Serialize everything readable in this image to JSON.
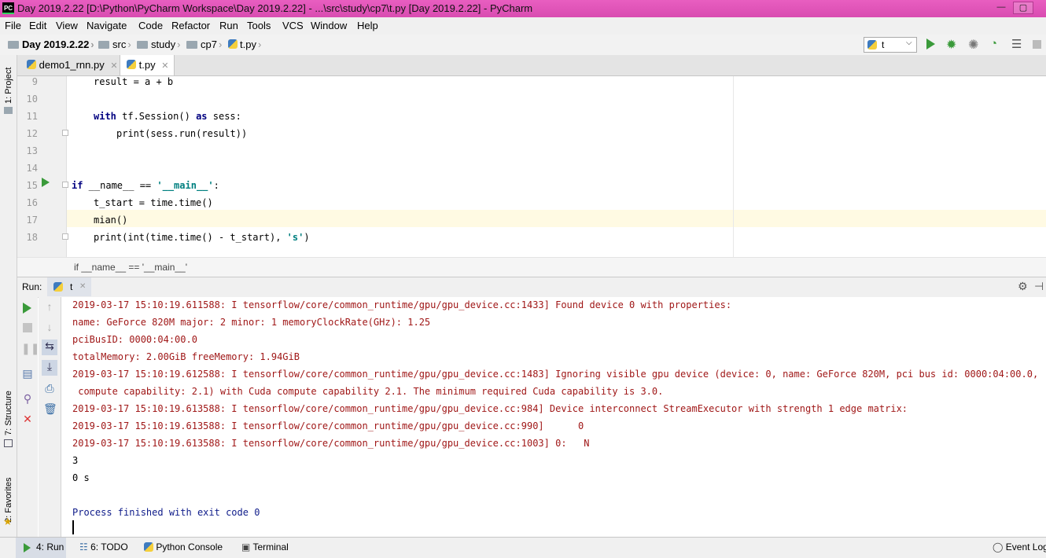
{
  "window": {
    "title": "Day 2019.2.22 [D:\\Python\\PyCharm Workspace\\Day 2019.2.22] - ...\\src\\study\\cp7\\t.py [Day 2019.2.22] - PyCharm",
    "logo_text": "PC",
    "min_glyph": "—",
    "max_glyph": "▢",
    "accent": "#d94cb1"
  },
  "menu": [
    "File",
    "Edit",
    "View",
    "Navigate",
    "Code",
    "Refactor",
    "Run",
    "Tools",
    "VCS",
    "Window",
    "Help"
  ],
  "breadcrumb": [
    "Day 2019.2.22",
    "src",
    "study",
    "cp7",
    "t.py"
  ],
  "run_config": {
    "name": "t"
  },
  "toolbar_icons": [
    "run-icon",
    "debug-icon",
    "coverage-icon",
    "profile-icon",
    "concurrency-icon",
    "stop-icon"
  ],
  "left_strip": {
    "project": "1: Project",
    "structure": "7: Structure",
    "favorites": "2: Favorites"
  },
  "tabs": [
    {
      "label": "demo1_rnn.py",
      "active": false
    },
    {
      "label": "t.py",
      "active": true
    }
  ],
  "editor": {
    "line_numbers": [
      "9",
      "10",
      "11",
      "12",
      "13",
      "14",
      "15",
      "16",
      "17",
      "18"
    ],
    "lines": {
      "l9": "result = a + b",
      "l11_kw": "with",
      "l11_mid": " tf.Session() ",
      "l11_kw2": "as",
      "l11_end": " sess:",
      "l12": "print(sess.run(result))",
      "l15_kw": "if",
      "l15_mid": " __name__ == ",
      "l15_str": "'__main__'",
      "l15_end": ":",
      "l16": "t_start = time.time()",
      "l17": "mian()",
      "l18_a": "print(int(time.time() - t_start), ",
      "l18_str": "'s'",
      "l18_b": ")"
    },
    "structure_crumb": "if __name__ == '__main__'"
  },
  "run_panel": {
    "label": "Run:",
    "tab": "t",
    "console": [
      {
        "text": "2019-03-17 15:10:19.611588: I tensorflow/core/common_runtime/gpu/gpu_device.cc:1433] Found device 0 with properties:",
        "kind": "err"
      },
      {
        "text": "name: GeForce 820M major: 2 minor: 1 memoryClockRate(GHz): 1.25",
        "kind": "err"
      },
      {
        "text": "pciBusID: 0000:04:00.0",
        "kind": "err"
      },
      {
        "text": "totalMemory: 2.00GiB freeMemory: 1.94GiB",
        "kind": "err"
      },
      {
        "text": "2019-03-17 15:10:19.612588: I tensorflow/core/common_runtime/gpu/gpu_device.cc:1483] Ignoring visible gpu device (device: 0, name: GeForce 820M, pci bus id: 0000:04:00.0,",
        "kind": "err"
      },
      {
        "text": " compute capability: 2.1) with Cuda compute capability 2.1. The minimum required Cuda capability is 3.0.",
        "kind": "err"
      },
      {
        "text": "2019-03-17 15:10:19.613588: I tensorflow/core/common_runtime/gpu/gpu_device.cc:984] Device interconnect StreamExecutor with strength 1 edge matrix:",
        "kind": "err"
      },
      {
        "text": "2019-03-17 15:10:19.613588: I tensorflow/core/common_runtime/gpu/gpu_device.cc:990]      0",
        "kind": "err"
      },
      {
        "text": "2019-03-17 15:10:19.613588: I tensorflow/core/common_runtime/gpu/gpu_device.cc:1003] 0:   N",
        "kind": "err"
      },
      {
        "text": "3",
        "kind": "out"
      },
      {
        "text": "0 s",
        "kind": "out"
      },
      {
        "text": "",
        "kind": "out"
      },
      {
        "text": "Process finished with exit code 0",
        "kind": "fin"
      }
    ]
  },
  "bottom": {
    "run": "4: Run",
    "todo": "6: TODO",
    "python_console": "Python Console",
    "terminal": "Terminal",
    "event_log": "Event Log"
  }
}
